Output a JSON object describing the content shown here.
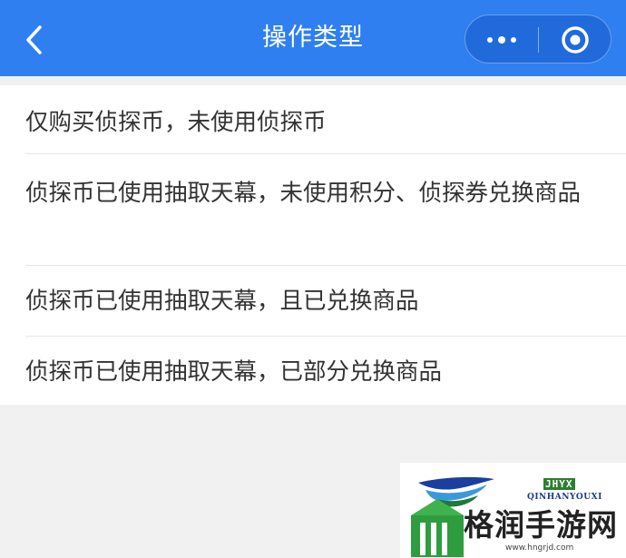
{
  "navbar": {
    "title": "操作类型",
    "back_icon": "chevron-left-icon",
    "more_icon": "more-dots-icon",
    "close_icon": "record-circle-icon",
    "bg_color": "#2f7ff1"
  },
  "list": {
    "items": [
      {
        "label": "仅购买侦探币，未使用侦探币"
      },
      {
        "label": "侦探币已使用抽取天幕，未使用积分、侦探券兑换商品"
      },
      {
        "label": "侦探币已使用抽取天幕，且已兑换商品"
      },
      {
        "label": "侦探币已使用抽取天幕，已部分兑换商品"
      }
    ]
  },
  "watermark": {
    "abbr": "JHYX",
    "en": "QINHANYOUXI",
    "cn": "格润手游网",
    "url": "www.hngrjd.com"
  }
}
